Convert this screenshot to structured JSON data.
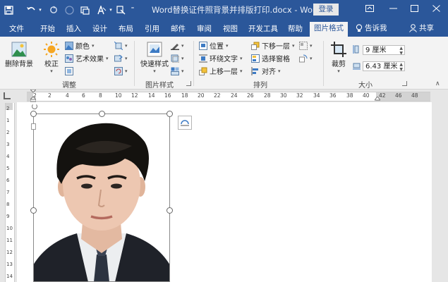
{
  "title_bar": {
    "document_title": "Word替换证件照背景并排版打印.docx - Word",
    "login_label": "登录",
    "quick_access": [
      "save-icon",
      "undo-icon",
      "redo-icon",
      "touch-mode-icon",
      "format-painter-icon",
      "customize-icon"
    ],
    "window_controls": [
      "ribbon-options-icon",
      "minimize-icon",
      "restore-icon",
      "close-icon"
    ]
  },
  "tabs": [
    {
      "label": "文件"
    },
    {
      "label": "开始"
    },
    {
      "label": "插入"
    },
    {
      "label": "设计"
    },
    {
      "label": "布局"
    },
    {
      "label": "引用"
    },
    {
      "label": "邮件"
    },
    {
      "label": "审阅"
    },
    {
      "label": "视图"
    },
    {
      "label": "开发工具"
    },
    {
      "label": "帮助"
    },
    {
      "label": "图片格式"
    }
  ],
  "active_tab": "图片格式",
  "tell_me": "告诉我",
  "share": "共享",
  "ribbon": {
    "remove_bg": "删除背景",
    "correct": "校正",
    "color": "颜色",
    "artistic": "艺术效果",
    "group_adjust": "调整",
    "quick_styles": "快速样式",
    "group_styles": "图片样式",
    "position": "位置",
    "wrap_text": "环绕文字",
    "bring_forward": "上移一层",
    "send_backward": "下移一层",
    "selection_pane": "选择窗格",
    "align": "对齐",
    "group_arrange": "排列",
    "crop": "裁剪",
    "height_value": "9 厘米",
    "width_value": "6.43 厘米",
    "group_size": "大小"
  },
  "ruler": {
    "ticks": [
      "2",
      "2",
      "4",
      "6",
      "8",
      "10",
      "12",
      "14",
      "16",
      "18",
      "20",
      "22",
      "24",
      "26",
      "28",
      "30",
      "32",
      "34",
      "36",
      "38",
      "40",
      "42",
      "46",
      "48"
    ],
    "vticks": [
      "2",
      "1",
      "2",
      "3",
      "4",
      "5",
      "6",
      "7",
      "8",
      "9",
      "10",
      "11",
      "12",
      "13",
      "14"
    ]
  },
  "colors": {
    "word_blue": "#2b579a",
    "ribbon_bg": "#f3f3f3"
  }
}
